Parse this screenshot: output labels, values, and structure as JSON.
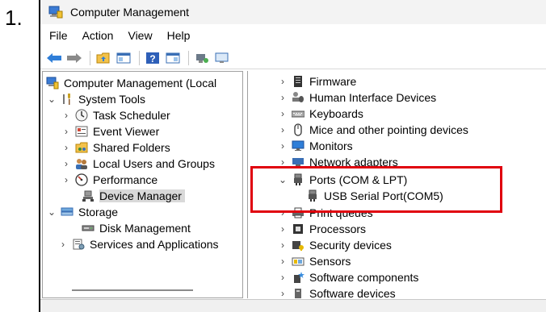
{
  "step_number": "1.",
  "window": {
    "title": "Computer Management"
  },
  "menu": [
    "File",
    "Action",
    "View",
    "Help"
  ],
  "toolbar_icons": [
    "back-arrow-icon",
    "forward-arrow-icon",
    "up-folder-icon",
    "show-hide-tree-icon",
    "help-icon",
    "properties-icon",
    "scan-hardware-icon",
    "update-driver-icon"
  ],
  "left_tree": {
    "root": "Computer Management (Local",
    "system_tools": {
      "label": "System Tools",
      "children": [
        "Task Scheduler",
        "Event Viewer",
        "Shared Folders",
        "Local Users and Groups",
        "Performance",
        "Device Manager"
      ]
    },
    "storage": {
      "label": "Storage",
      "children": [
        "Disk Management"
      ]
    },
    "services": "Services and Applications"
  },
  "device_tree": {
    "firmware": "Firmware",
    "hid": "Human Interface Devices",
    "keyboards": "Keyboards",
    "mice": "Mice and other pointing devices",
    "monitors": "Monitors",
    "network": "Network adapters",
    "ports": "Ports (COM & LPT)",
    "usb_serial": "USB Serial Port(COM5)",
    "print_queues": "Print queues",
    "processors": "Processors",
    "security": "Security devices",
    "sensors": "Sensors",
    "software_components": "Software components",
    "software_devices": "Software devices"
  },
  "colors": {
    "highlight": "#e0000d",
    "selection": "#d9d9d9"
  }
}
